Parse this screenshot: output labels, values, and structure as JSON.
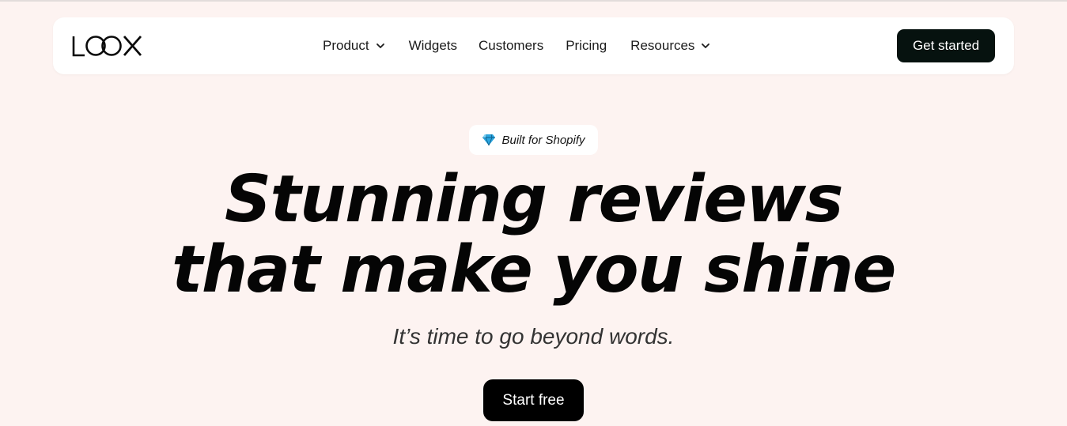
{
  "brand": {
    "logo_text": "LOOX",
    "logo_icon": "loox-logo"
  },
  "nav": {
    "items": [
      {
        "label": "Product",
        "has_dropdown": true,
        "icon": "chevron-down-icon"
      },
      {
        "label": "Widgets",
        "has_dropdown": false
      },
      {
        "label": "Customers",
        "has_dropdown": false
      },
      {
        "label": "Pricing",
        "has_dropdown": false
      },
      {
        "label": "Resources",
        "has_dropdown": true,
        "icon": "chevron-down-icon"
      }
    ],
    "cta_label": "Get started"
  },
  "hero": {
    "badge_icon": "diamond-gem-icon",
    "badge_label": "Built for Shopify",
    "headline_line1": "Stunning reviews",
    "headline_line2": "that make you shine",
    "subheadline": "It’s time to go beyond words.",
    "cta_label": "Start free"
  },
  "colors": {
    "page_background": "#fdf3f1",
    "navbar_background": "#ffffff",
    "primary_button": "#06120f",
    "hero_button": "#000000",
    "gem_blue": "#2aa6e0"
  }
}
